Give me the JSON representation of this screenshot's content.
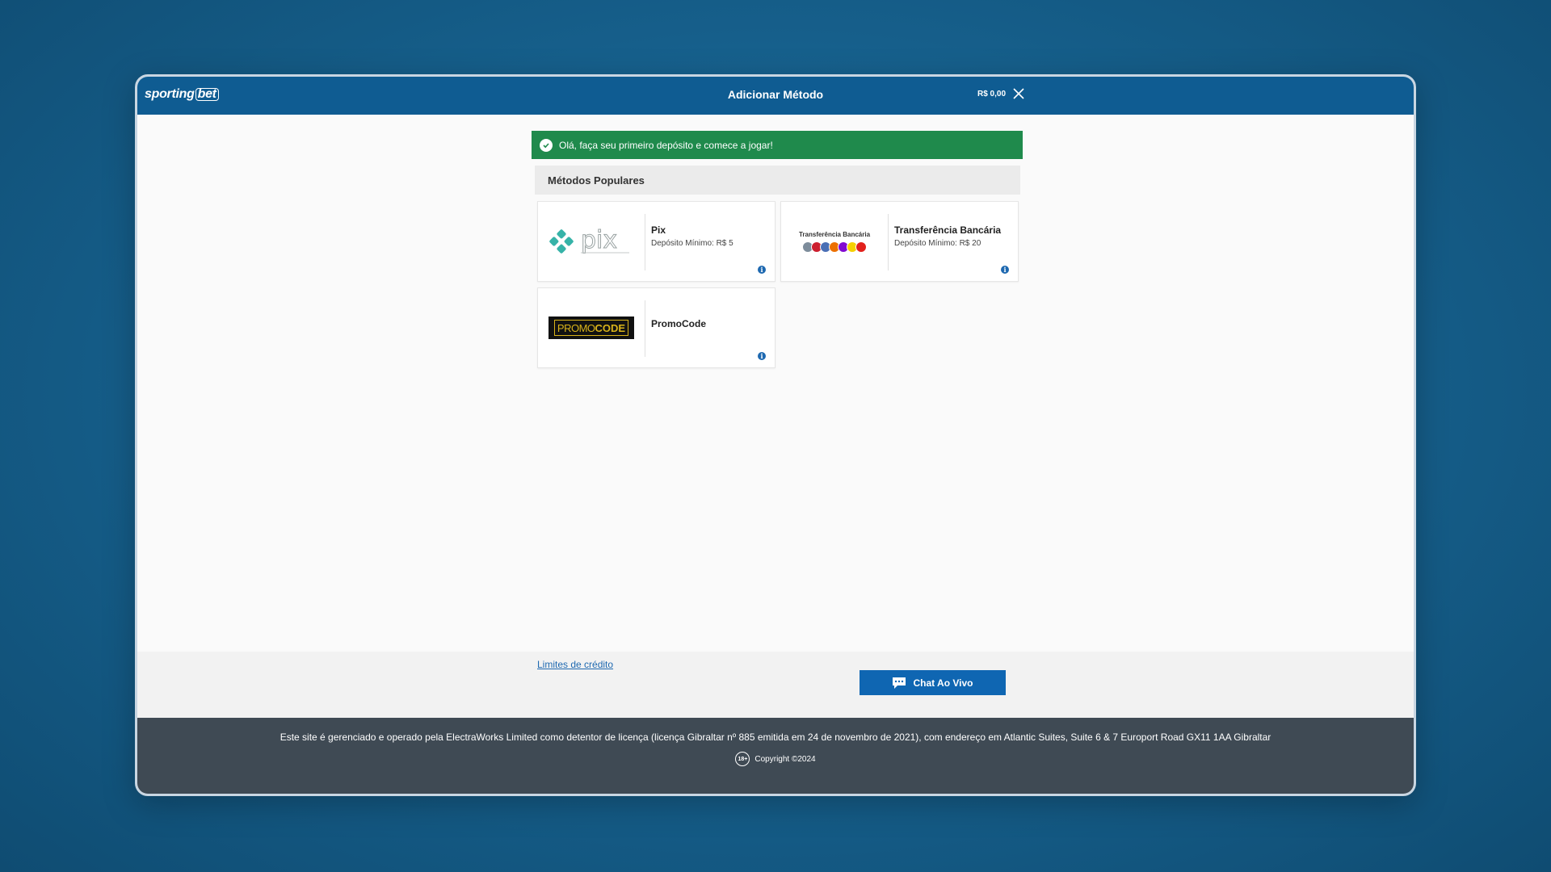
{
  "header": {
    "brand": "sporting",
    "brand_box": "bet",
    "title": "Adicionar Método",
    "balance": "R$ 0,00"
  },
  "banner": {
    "message": "Olá, faça seu primeiro depósito e comece a jogar!"
  },
  "section": {
    "title": "Métodos Populares"
  },
  "methods": [
    {
      "name": "Pix",
      "min": "Depósito Mínimo: R$ 5",
      "logo_text": "pix"
    },
    {
      "name": "Transferência Bancária",
      "min": "Depósito Mínimo: R$ 20",
      "logo_text": "Transferência Bancária"
    },
    {
      "name": "PromoCode",
      "min": "",
      "logo_text_1": "PROMO",
      "logo_text_2": "CODE"
    }
  ],
  "links": {
    "limits": "Limites de crédito"
  },
  "chat": {
    "label": "Chat Ao Vivo"
  },
  "legal": {
    "text": "Este site é gerenciado e operado pela ElectraWorks Limited como detentor de licença (licença Gibraltar nº 885 emitida em 24 de novembro de 2021), com endereço em Atlantic Suites, Suite 6 & 7 Europort Road GX11 1AA Gibraltar",
    "age": "18+",
    "copyright": "Copyright ©2024"
  },
  "colors": {
    "header": "#0f5c92",
    "success": "#1f8a4c",
    "primary": "#0f66b2",
    "footer": "#3f4a54"
  }
}
